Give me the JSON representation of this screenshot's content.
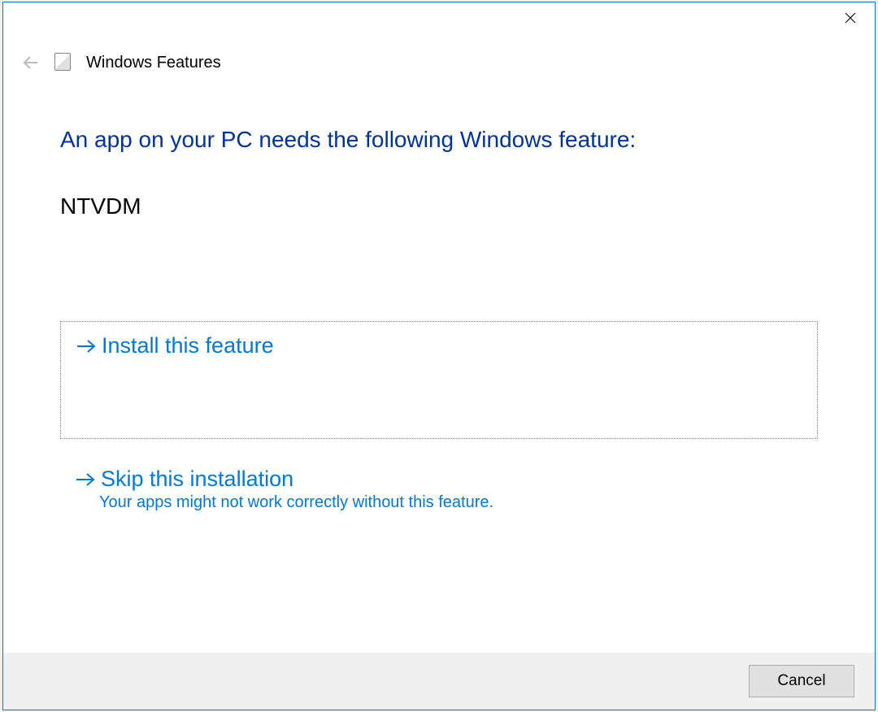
{
  "header": {
    "app_title": "Windows Features"
  },
  "main": {
    "headline": "An app on your PC needs the following Windows feature:",
    "feature_name": "NTVDM"
  },
  "options": {
    "install": {
      "title": "Install this feature"
    },
    "skip": {
      "title": "Skip this installation",
      "subtitle": "Your apps might not work correctly without this feature."
    }
  },
  "footer": {
    "cancel_label": "Cancel"
  }
}
